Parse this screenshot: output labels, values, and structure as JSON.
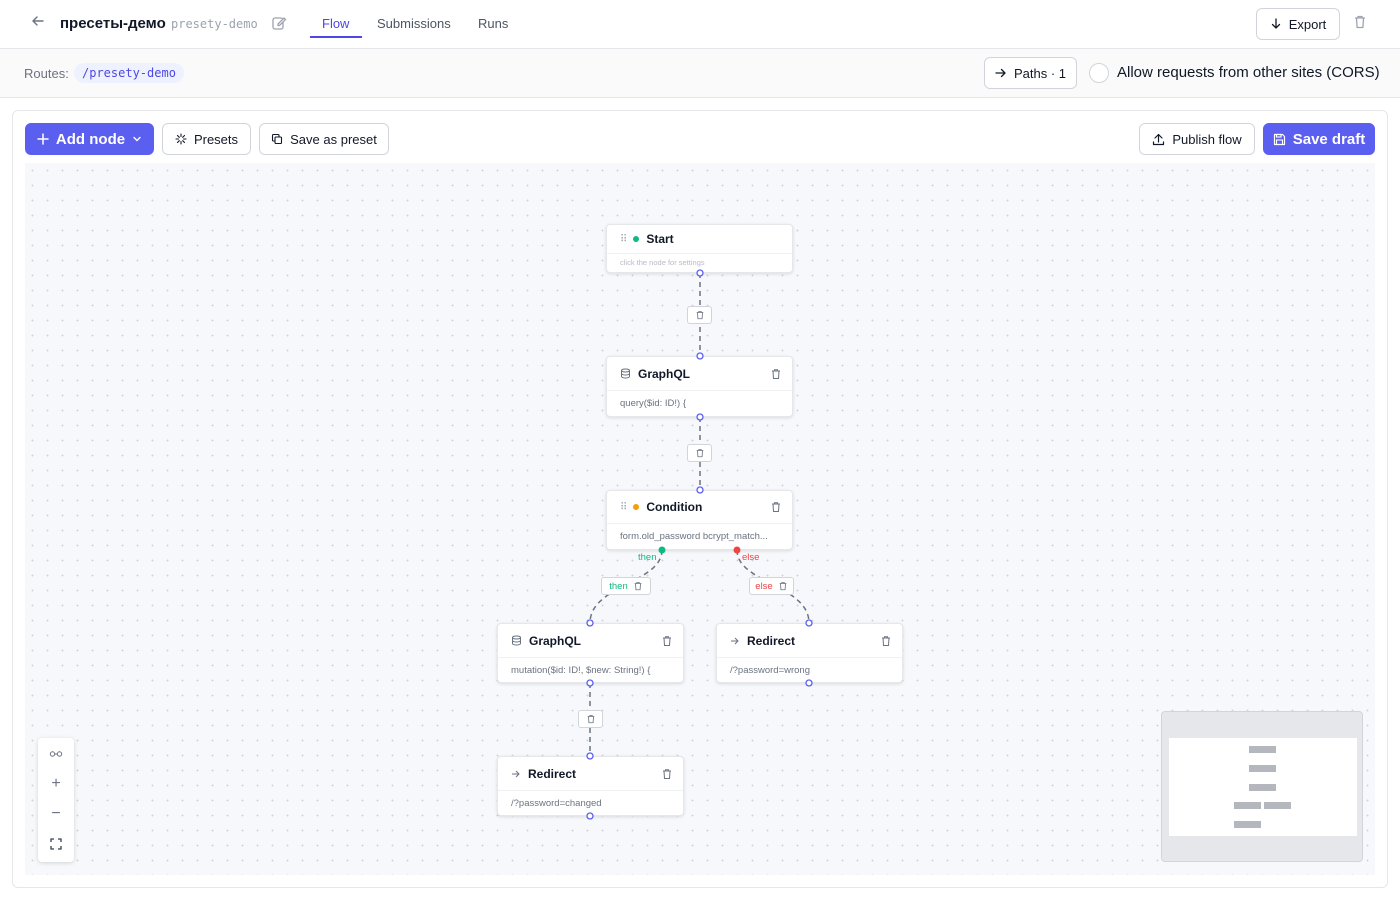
{
  "header": {
    "title": "пресеты-демо",
    "slug": "presety-demo",
    "tabs": [
      {
        "label": "Flow",
        "active": true
      },
      {
        "label": "Submissions",
        "active": false
      },
      {
        "label": "Runs",
        "active": false
      }
    ],
    "export_label": "Export"
  },
  "routes": {
    "label": "Routes:",
    "items": [
      "/presety-demo"
    ],
    "paths_label": "Paths · 1",
    "cors_label": "Allow requests from other sites (CORS)",
    "cors_enabled": false
  },
  "toolbar": {
    "add_node_label": "Add node",
    "presets_label": "Presets",
    "save_as_preset_label": "Save as preset",
    "publish_label": "Publish flow",
    "save_draft_label": "Save draft"
  },
  "nodes": {
    "start": {
      "title": "Start",
      "body": "click the node for settings"
    },
    "graphql1": {
      "title": "GraphQL",
      "body": "query($id: ID!) {"
    },
    "condition": {
      "title": "Condition",
      "body": "form.old_password bcrypt_match..."
    },
    "graphql2": {
      "title": "GraphQL",
      "body": "mutation($id: ID!, $new: String!) {"
    },
    "redirect_wrong": {
      "title": "Redirect",
      "body": "/?password=wrong"
    },
    "redirect_changed": {
      "title": "Redirect",
      "body": "/?password=changed"
    }
  },
  "branches": {
    "then": "then",
    "else": "else"
  },
  "colors": {
    "accent": "#4f46e5",
    "primary_button": "#5b5ff0",
    "start_dot": "#10b981",
    "condition_dot": "#f59e0b",
    "then": "#10b981",
    "else": "#ef4444"
  }
}
